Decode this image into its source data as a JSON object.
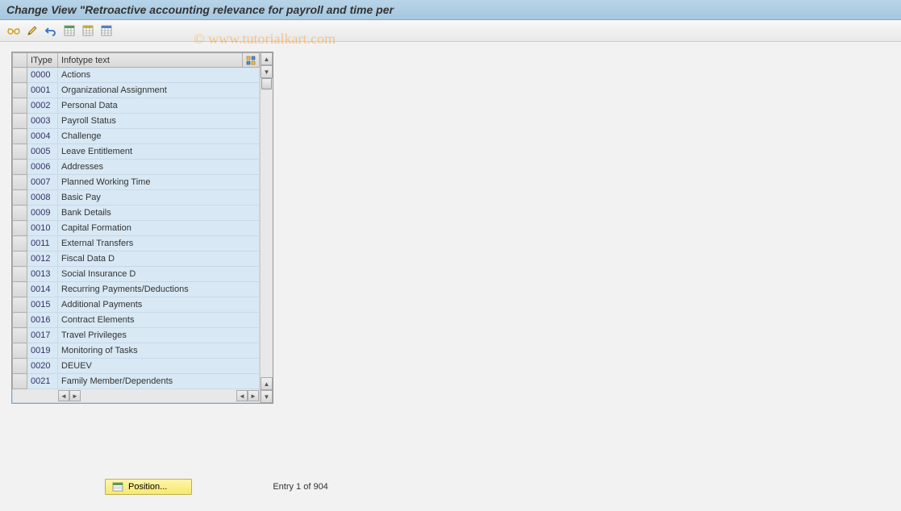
{
  "title": "Change View \"Retroactive accounting relevance for payroll and time per",
  "watermark": "© www.tutorialkart.com",
  "toolbar": {
    "icons": [
      "glasses",
      "pencil",
      "undo",
      "grid-green",
      "grid-yellow",
      "grid-blue"
    ]
  },
  "table": {
    "headers": {
      "itype": "IType",
      "text": "Infotype text"
    },
    "rows": [
      {
        "itype": "0000",
        "text": "Actions"
      },
      {
        "itype": "0001",
        "text": "Organizational Assignment"
      },
      {
        "itype": "0002",
        "text": "Personal Data"
      },
      {
        "itype": "0003",
        "text": "Payroll Status"
      },
      {
        "itype": "0004",
        "text": "Challenge"
      },
      {
        "itype": "0005",
        "text": "Leave Entitlement"
      },
      {
        "itype": "0006",
        "text": "Addresses"
      },
      {
        "itype": "0007",
        "text": "Planned Working Time"
      },
      {
        "itype": "0008",
        "text": "Basic Pay"
      },
      {
        "itype": "0009",
        "text": "Bank Details"
      },
      {
        "itype": "0010",
        "text": "Capital Formation"
      },
      {
        "itype": "0011",
        "text": "External Transfers"
      },
      {
        "itype": "0012",
        "text": "Fiscal Data  D"
      },
      {
        "itype": "0013",
        "text": "Social Insurance  D"
      },
      {
        "itype": "0014",
        "text": "Recurring Payments/Deductions"
      },
      {
        "itype": "0015",
        "text": "Additional Payments"
      },
      {
        "itype": "0016",
        "text": "Contract Elements"
      },
      {
        "itype": "0017",
        "text": "Travel Privileges"
      },
      {
        "itype": "0019",
        "text": "Monitoring of Tasks"
      },
      {
        "itype": "0020",
        "text": "DEUEV"
      },
      {
        "itype": "0021",
        "text": "Family Member/Dependents"
      }
    ]
  },
  "footer": {
    "position_label": "Position...",
    "entry_text": "Entry 1 of 904"
  }
}
